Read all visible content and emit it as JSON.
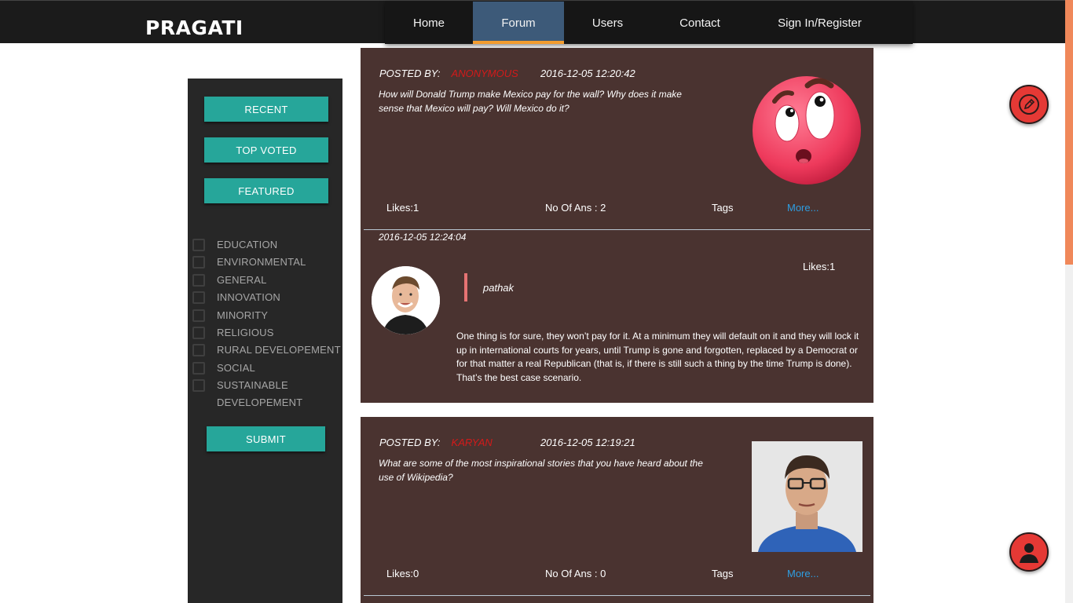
{
  "header": {
    "brand": "PRAGATI",
    "nav": [
      {
        "label": "Home"
      },
      {
        "label": "Forum",
        "active": true
      },
      {
        "label": "Users"
      },
      {
        "label": "Contact"
      },
      {
        "label": "Sign In/Register"
      }
    ]
  },
  "colors": {
    "accent": "#26a69a",
    "brand_dark": "#1b1b1b",
    "post_bg": "#4a3330",
    "active_nav": "#3d5a79",
    "nav_underline": "#f39c2f",
    "username": "#d31a1a",
    "link": "#2e9de0",
    "fab": "#e53935"
  },
  "sidebar": {
    "buttons": {
      "recent": "RECENT",
      "top_voted": "TOP VOTED",
      "featured": "FEATURED"
    },
    "categories": [
      "EDUCATION",
      "ENVIRONMENTAL",
      "GENERAL",
      "INNOVATION",
      "MINORITY",
      "RELIGIOUS",
      "RURAL DEVELOPEMENT",
      "SOCIAL",
      "SUSTAINABLE DEVELOPEMENT"
    ],
    "submit": "SUBMIT"
  },
  "posts": [
    {
      "posted_by_label": "POSTED BY:",
      "user": "ANONYMOUS",
      "date": "2016-12-05 12:20:42",
      "question": "How will Donald Trump make Mexico pay for the wall? Why does it make sense that Mexico will pay? Will Mexico do it?",
      "likes": "Likes:1",
      "answers": "No Of Ans : 2",
      "tags": "Tags",
      "more": "More...",
      "image": "surprised-emoji-icon",
      "answer": {
        "date": "2016-12-05 12:24:04",
        "likes": "Likes:1",
        "user": "pathak",
        "text": "One thing is for sure, they won’t pay for it. At a minimum they will default on it and they will lock it up in international courts for years, until Trump is gone and forgotten, replaced by a Democrat or for that matter a real Republican (that is, if there is still such a thing by the time Trump is done). That’s the best case scenario."
      }
    },
    {
      "posted_by_label": "POSTED BY:",
      "user": "KARYAN",
      "date": "2016-12-05 12:19:21",
      "question": "What are some of the most inspirational stories that you have heard about the use of Wikipedia?",
      "likes": "Likes:0",
      "answers": "No Of Ans : 0",
      "tags": "Tags",
      "more": "More...",
      "image": "user-photo"
    }
  ],
  "fabs": {
    "edit": "pencil-icon",
    "profile": "user-silhouette-icon"
  }
}
